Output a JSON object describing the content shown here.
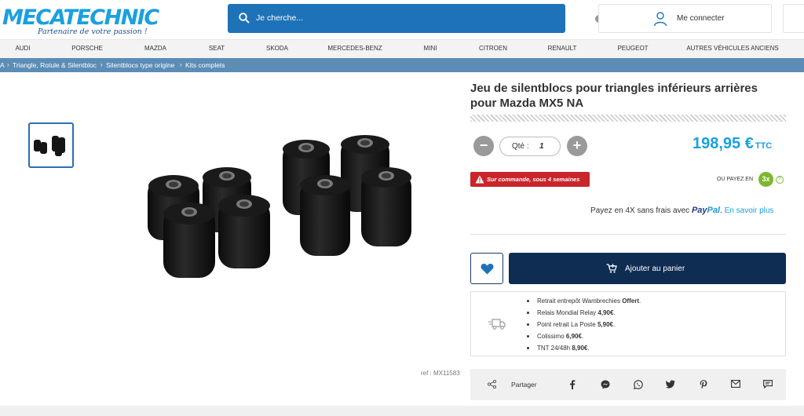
{
  "header": {
    "logo_text": "MECATECHNIC",
    "logo_tagline": "Partenaire de votre passion !",
    "search_placeholder": "Je cherche...",
    "login_label": "Me connecter"
  },
  "nav": [
    "AUDI",
    "PORSCHE",
    "MAZDA",
    "SEAT",
    "SKODA",
    "MERCEDES-BENZ",
    "MINI",
    "CITROEN",
    "RENAULT",
    "PEUGEOT",
    "AUTRES VÉHICULES ANCIENS"
  ],
  "breadcrumb": [
    "A",
    "Triangle, Rotule & Silentbloc",
    "Silentblocs type origine",
    "Kits complets"
  ],
  "breadcrumb_sep": "›",
  "product": {
    "title_line1": "Jeu de silentblocs pour triangles inférieurs arrières",
    "title_line2": "pour Mazda MX5 NA",
    "quantity_label": "Qté :",
    "quantity_value": "1",
    "minus": "−",
    "plus": "+",
    "price": "198,95 €",
    "price_suffix": "TTC",
    "availability": "Sur commande, sous 4 semaines",
    "pay_in_label": "OU PAYEZ EN",
    "pay_in_count": "3x",
    "help": "?",
    "paypal_prefix": "Payez en 4X sans frais avec",
    "paypal_brand_1": "Pay",
    "paypal_brand_2": "Pal",
    "paypal_more": "En savoir plus",
    "add_to_cart": "Ajouter au panier",
    "ref": "ref : MX11583"
  },
  "shipping": [
    {
      "label": "Retrait entrepôt Wambrechies",
      "price": "Offert",
      "suffix": "."
    },
    {
      "label": "Relais Mondial Relay",
      "price": "4,90€",
      "suffix": "."
    },
    {
      "label": "Point retrait La Poste",
      "price": "5,90€",
      "suffix": "."
    },
    {
      "label": "Colissimo",
      "price": "6,90€",
      "suffix": "."
    },
    {
      "label": "TNT 24/48h",
      "price": "8,90€",
      "suffix": "."
    }
  ],
  "share": {
    "label": "Partager",
    "icons": [
      "share-icon",
      "facebook-icon",
      "messenger-icon",
      "whatsapp-icon",
      "twitter-icon",
      "pinterest-icon",
      "email-icon",
      "sms-icon"
    ]
  },
  "colors": {
    "brand_blue": "#1aa0df",
    "search_blue": "#1e73b8",
    "breadcrumb_bg": "#5b8db6",
    "dark_navy": "#0f2d52",
    "alert_red": "#c9252b",
    "green": "#7bb82e"
  }
}
